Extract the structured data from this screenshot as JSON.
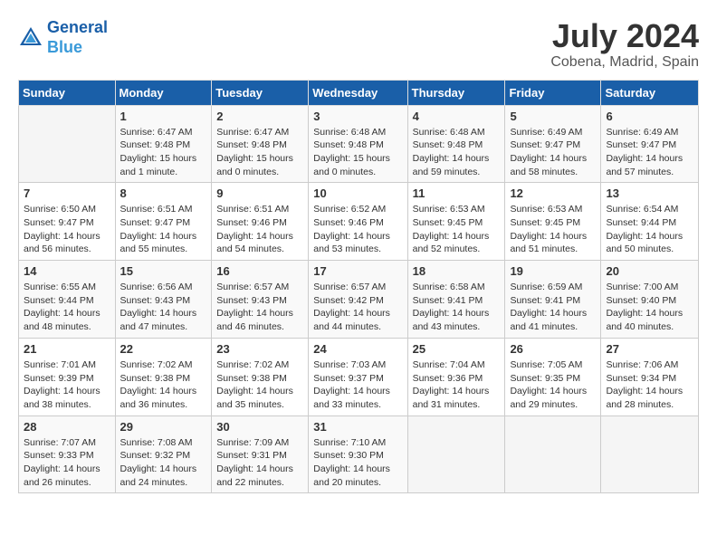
{
  "header": {
    "logo_line1": "General",
    "logo_line2": "Blue",
    "month_year": "July 2024",
    "location": "Cobena, Madrid, Spain"
  },
  "weekdays": [
    "Sunday",
    "Monday",
    "Tuesday",
    "Wednesday",
    "Thursday",
    "Friday",
    "Saturday"
  ],
  "weeks": [
    [
      {
        "day": "",
        "sunrise": "",
        "sunset": "",
        "daylight": ""
      },
      {
        "day": "1",
        "sunrise": "Sunrise: 6:47 AM",
        "sunset": "Sunset: 9:48 PM",
        "daylight": "Daylight: 15 hours and 1 minute."
      },
      {
        "day": "2",
        "sunrise": "Sunrise: 6:47 AM",
        "sunset": "Sunset: 9:48 PM",
        "daylight": "Daylight: 15 hours and 0 minutes."
      },
      {
        "day": "3",
        "sunrise": "Sunrise: 6:48 AM",
        "sunset": "Sunset: 9:48 PM",
        "daylight": "Daylight: 15 hours and 0 minutes."
      },
      {
        "day": "4",
        "sunrise": "Sunrise: 6:48 AM",
        "sunset": "Sunset: 9:48 PM",
        "daylight": "Daylight: 14 hours and 59 minutes."
      },
      {
        "day": "5",
        "sunrise": "Sunrise: 6:49 AM",
        "sunset": "Sunset: 9:47 PM",
        "daylight": "Daylight: 14 hours and 58 minutes."
      },
      {
        "day": "6",
        "sunrise": "Sunrise: 6:49 AM",
        "sunset": "Sunset: 9:47 PM",
        "daylight": "Daylight: 14 hours and 57 minutes."
      }
    ],
    [
      {
        "day": "7",
        "sunrise": "Sunrise: 6:50 AM",
        "sunset": "Sunset: 9:47 PM",
        "daylight": "Daylight: 14 hours and 56 minutes."
      },
      {
        "day": "8",
        "sunrise": "Sunrise: 6:51 AM",
        "sunset": "Sunset: 9:47 PM",
        "daylight": "Daylight: 14 hours and 55 minutes."
      },
      {
        "day": "9",
        "sunrise": "Sunrise: 6:51 AM",
        "sunset": "Sunset: 9:46 PM",
        "daylight": "Daylight: 14 hours and 54 minutes."
      },
      {
        "day": "10",
        "sunrise": "Sunrise: 6:52 AM",
        "sunset": "Sunset: 9:46 PM",
        "daylight": "Daylight: 14 hours and 53 minutes."
      },
      {
        "day": "11",
        "sunrise": "Sunrise: 6:53 AM",
        "sunset": "Sunset: 9:45 PM",
        "daylight": "Daylight: 14 hours and 52 minutes."
      },
      {
        "day": "12",
        "sunrise": "Sunrise: 6:53 AM",
        "sunset": "Sunset: 9:45 PM",
        "daylight": "Daylight: 14 hours and 51 minutes."
      },
      {
        "day": "13",
        "sunrise": "Sunrise: 6:54 AM",
        "sunset": "Sunset: 9:44 PM",
        "daylight": "Daylight: 14 hours and 50 minutes."
      }
    ],
    [
      {
        "day": "14",
        "sunrise": "Sunrise: 6:55 AM",
        "sunset": "Sunset: 9:44 PM",
        "daylight": "Daylight: 14 hours and 48 minutes."
      },
      {
        "day": "15",
        "sunrise": "Sunrise: 6:56 AM",
        "sunset": "Sunset: 9:43 PM",
        "daylight": "Daylight: 14 hours and 47 minutes."
      },
      {
        "day": "16",
        "sunrise": "Sunrise: 6:57 AM",
        "sunset": "Sunset: 9:43 PM",
        "daylight": "Daylight: 14 hours and 46 minutes."
      },
      {
        "day": "17",
        "sunrise": "Sunrise: 6:57 AM",
        "sunset": "Sunset: 9:42 PM",
        "daylight": "Daylight: 14 hours and 44 minutes."
      },
      {
        "day": "18",
        "sunrise": "Sunrise: 6:58 AM",
        "sunset": "Sunset: 9:41 PM",
        "daylight": "Daylight: 14 hours and 43 minutes."
      },
      {
        "day": "19",
        "sunrise": "Sunrise: 6:59 AM",
        "sunset": "Sunset: 9:41 PM",
        "daylight": "Daylight: 14 hours and 41 minutes."
      },
      {
        "day": "20",
        "sunrise": "Sunrise: 7:00 AM",
        "sunset": "Sunset: 9:40 PM",
        "daylight": "Daylight: 14 hours and 40 minutes."
      }
    ],
    [
      {
        "day": "21",
        "sunrise": "Sunrise: 7:01 AM",
        "sunset": "Sunset: 9:39 PM",
        "daylight": "Daylight: 14 hours and 38 minutes."
      },
      {
        "day": "22",
        "sunrise": "Sunrise: 7:02 AM",
        "sunset": "Sunset: 9:38 PM",
        "daylight": "Daylight: 14 hours and 36 minutes."
      },
      {
        "day": "23",
        "sunrise": "Sunrise: 7:02 AM",
        "sunset": "Sunset: 9:38 PM",
        "daylight": "Daylight: 14 hours and 35 minutes."
      },
      {
        "day": "24",
        "sunrise": "Sunrise: 7:03 AM",
        "sunset": "Sunset: 9:37 PM",
        "daylight": "Daylight: 14 hours and 33 minutes."
      },
      {
        "day": "25",
        "sunrise": "Sunrise: 7:04 AM",
        "sunset": "Sunset: 9:36 PM",
        "daylight": "Daylight: 14 hours and 31 minutes."
      },
      {
        "day": "26",
        "sunrise": "Sunrise: 7:05 AM",
        "sunset": "Sunset: 9:35 PM",
        "daylight": "Daylight: 14 hours and 29 minutes."
      },
      {
        "day": "27",
        "sunrise": "Sunrise: 7:06 AM",
        "sunset": "Sunset: 9:34 PM",
        "daylight": "Daylight: 14 hours and 28 minutes."
      }
    ],
    [
      {
        "day": "28",
        "sunrise": "Sunrise: 7:07 AM",
        "sunset": "Sunset: 9:33 PM",
        "daylight": "Daylight: 14 hours and 26 minutes."
      },
      {
        "day": "29",
        "sunrise": "Sunrise: 7:08 AM",
        "sunset": "Sunset: 9:32 PM",
        "daylight": "Daylight: 14 hours and 24 minutes."
      },
      {
        "day": "30",
        "sunrise": "Sunrise: 7:09 AM",
        "sunset": "Sunset: 9:31 PM",
        "daylight": "Daylight: 14 hours and 22 minutes."
      },
      {
        "day": "31",
        "sunrise": "Sunrise: 7:10 AM",
        "sunset": "Sunset: 9:30 PM",
        "daylight": "Daylight: 14 hours and 20 minutes."
      },
      {
        "day": "",
        "sunrise": "",
        "sunset": "",
        "daylight": ""
      },
      {
        "day": "",
        "sunrise": "",
        "sunset": "",
        "daylight": ""
      },
      {
        "day": "",
        "sunrise": "",
        "sunset": "",
        "daylight": ""
      }
    ]
  ]
}
